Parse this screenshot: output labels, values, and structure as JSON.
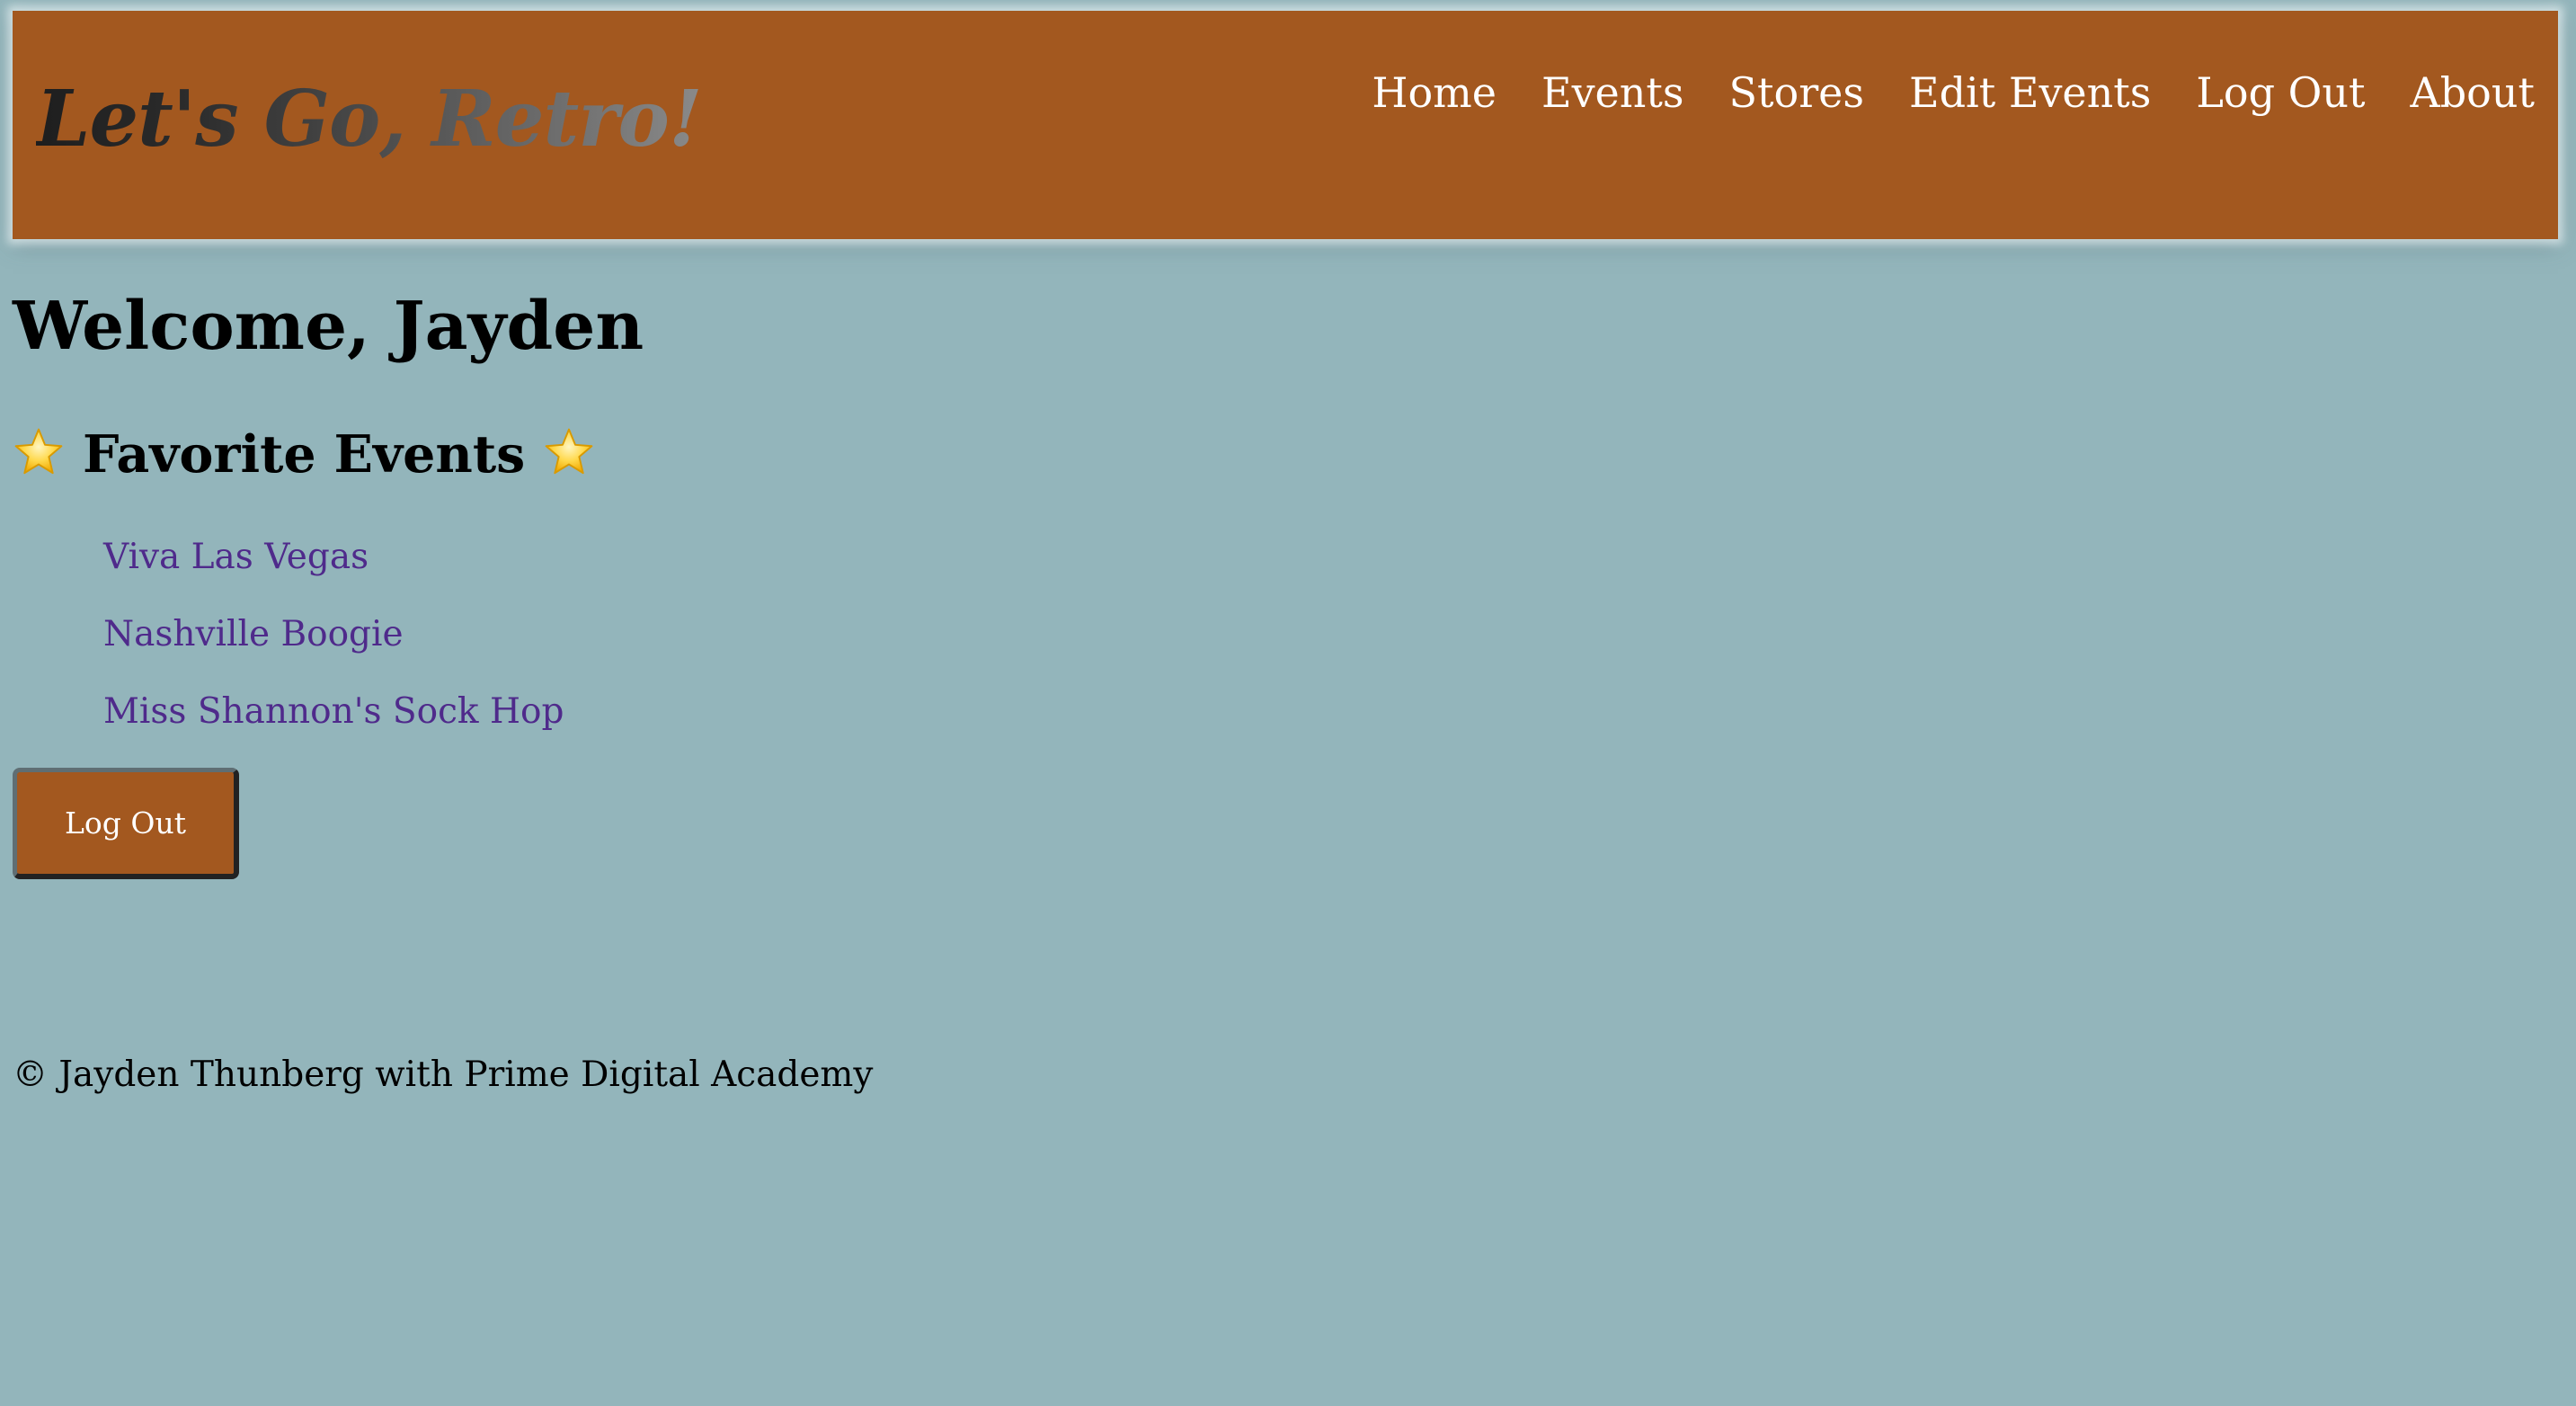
{
  "header": {
    "title": "Let's Go, Retro!",
    "nav_items": [
      "Home",
      "Events",
      "Stores",
      "Edit Events",
      "Log Out",
      "About"
    ]
  },
  "main": {
    "welcome": "Welcome, Jayden",
    "favorites_title": "Favorite Events",
    "favorites_icon": "star-icon",
    "favorite_events": [
      "Viva Las Vegas",
      "Nashville Boogie",
      "Miss Shannon's Sock Hop"
    ],
    "logout_button": "Log Out"
  },
  "footer": {
    "text": "© Jayden Thunberg with Prime Digital Academy"
  },
  "colors": {
    "background": "#93b5bb",
    "nav_background": "#a3581f",
    "nav_text": "#ffffff",
    "link": "#4f2a8b",
    "button_background": "#a3581f"
  }
}
